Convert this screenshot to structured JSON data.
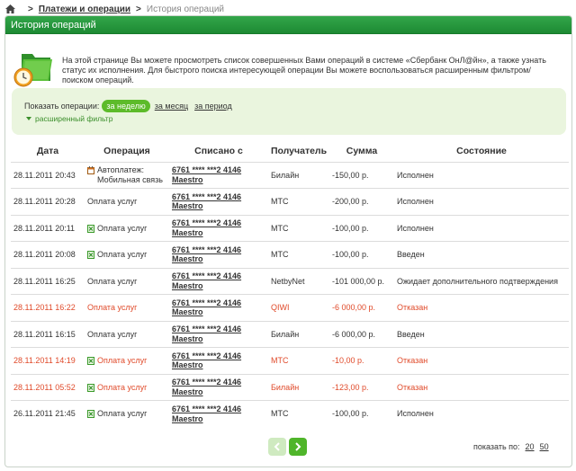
{
  "breadcrumb": {
    "link": "Платежи и операции",
    "current": "История операций"
  },
  "panel": {
    "title": "История операций"
  },
  "intro": {
    "text": "На этой странице Вы можете просмотреть список совершенных Вами операций в системе «Сбербанк ОнЛ@йн», а также узнать статус их исполнения. Для быстрого поиска интересующей операции Вы можете воспользоваться расширенным фильтром/поиском операций."
  },
  "filter": {
    "label": "Показать операции:",
    "week": "за неделю",
    "month": "за месяц",
    "period": "за период",
    "advanced": "расширенный фильтр"
  },
  "table": {
    "headers": {
      "date": "Дата",
      "operation": "Операция",
      "debited": "Списано с",
      "recipient": "Получатель",
      "amount": "Сумма",
      "status": "Состояние"
    },
    "rows": [
      {
        "date": "28.11.2011 20:43",
        "op": "Автоплатеж: Мобильная связь",
        "icon": "calendar",
        "card1": "6761 **** ***2 4146",
        "card2": "Maestro",
        "recipient": "Билайн",
        "amount": "-150,00 р.",
        "status": "Исполнен",
        "red": false
      },
      {
        "date": "28.11.2011 20:28",
        "op": "Оплата услуг",
        "icon": "none",
        "card1": "6761 **** ***2 4146",
        "card2": "Maestro",
        "recipient": "МТС",
        "amount": "-200,00 р.",
        "status": "Исполнен",
        "red": false
      },
      {
        "date": "28.11.2011 20:11",
        "op": "Оплата услуг",
        "icon": "excel",
        "card1": "6761 **** ***2 4146",
        "card2": "Maestro",
        "recipient": "МТС",
        "amount": "-100,00 р.",
        "status": "Исполнен",
        "red": false
      },
      {
        "date": "28.11.2011 20:08",
        "op": "Оплата услуг",
        "icon": "excel",
        "card1": "6761 **** ***2 4146",
        "card2": "Maestro",
        "recipient": "МТС",
        "amount": "-100,00 р.",
        "status": "Введен",
        "red": false
      },
      {
        "date": "28.11.2011 16:25",
        "op": "Оплата услуг",
        "icon": "none",
        "card1": "6761 **** ***2 4146",
        "card2": "Maestro",
        "recipient": "NetbyNet",
        "amount": "-101 000,00 р.",
        "status": "Ожидает дополнительного подтверждения",
        "red": false
      },
      {
        "date": "28.11.2011 16:22",
        "op": "Оплата услуг",
        "icon": "none",
        "card1": "6761 **** ***2 4146",
        "card2": "Maestro",
        "recipient": "QIWI",
        "amount": "-6 000,00 р.",
        "status": "Отказан",
        "red": true
      },
      {
        "date": "28.11.2011 16:15",
        "op": "Оплата услуг",
        "icon": "none",
        "card1": "6761 **** ***2 4146",
        "card2": "Maestro",
        "recipient": "Билайн",
        "amount": "-6 000,00 р.",
        "status": "Введен",
        "red": false
      },
      {
        "date": "28.11.2011 14:19",
        "op": "Оплата услуг",
        "icon": "excel",
        "card1": "6761 **** ***2 4146",
        "card2": "Maestro",
        "recipient": "МТС",
        "amount": "-10,00 р.",
        "status": "Отказан",
        "red": true
      },
      {
        "date": "28.11.2011 05:52",
        "op": "Оплата услуг",
        "icon": "excel",
        "card1": "6761 **** ***2 4146",
        "card2": "Maestro",
        "recipient": "Билайн",
        "amount": "-123,00 р.",
        "status": "Отказан",
        "red": true
      },
      {
        "date": "26.11.2011 21:45",
        "op": "Оплата услуг",
        "icon": "excel",
        "card1": "6761 **** ***2 4146",
        "card2": "Maestro",
        "recipient": "МТС",
        "amount": "-100,00 р.",
        "status": "Исполнен",
        "red": false
      }
    ]
  },
  "pager": {
    "show_label": "показать по:",
    "opt1": "20",
    "opt2": "50"
  },
  "colors": {
    "accent_green": "#1d8a33",
    "pill_green": "#5dbb2a",
    "error_red": "#e04a2a",
    "filter_bg": "#eaf5de"
  }
}
